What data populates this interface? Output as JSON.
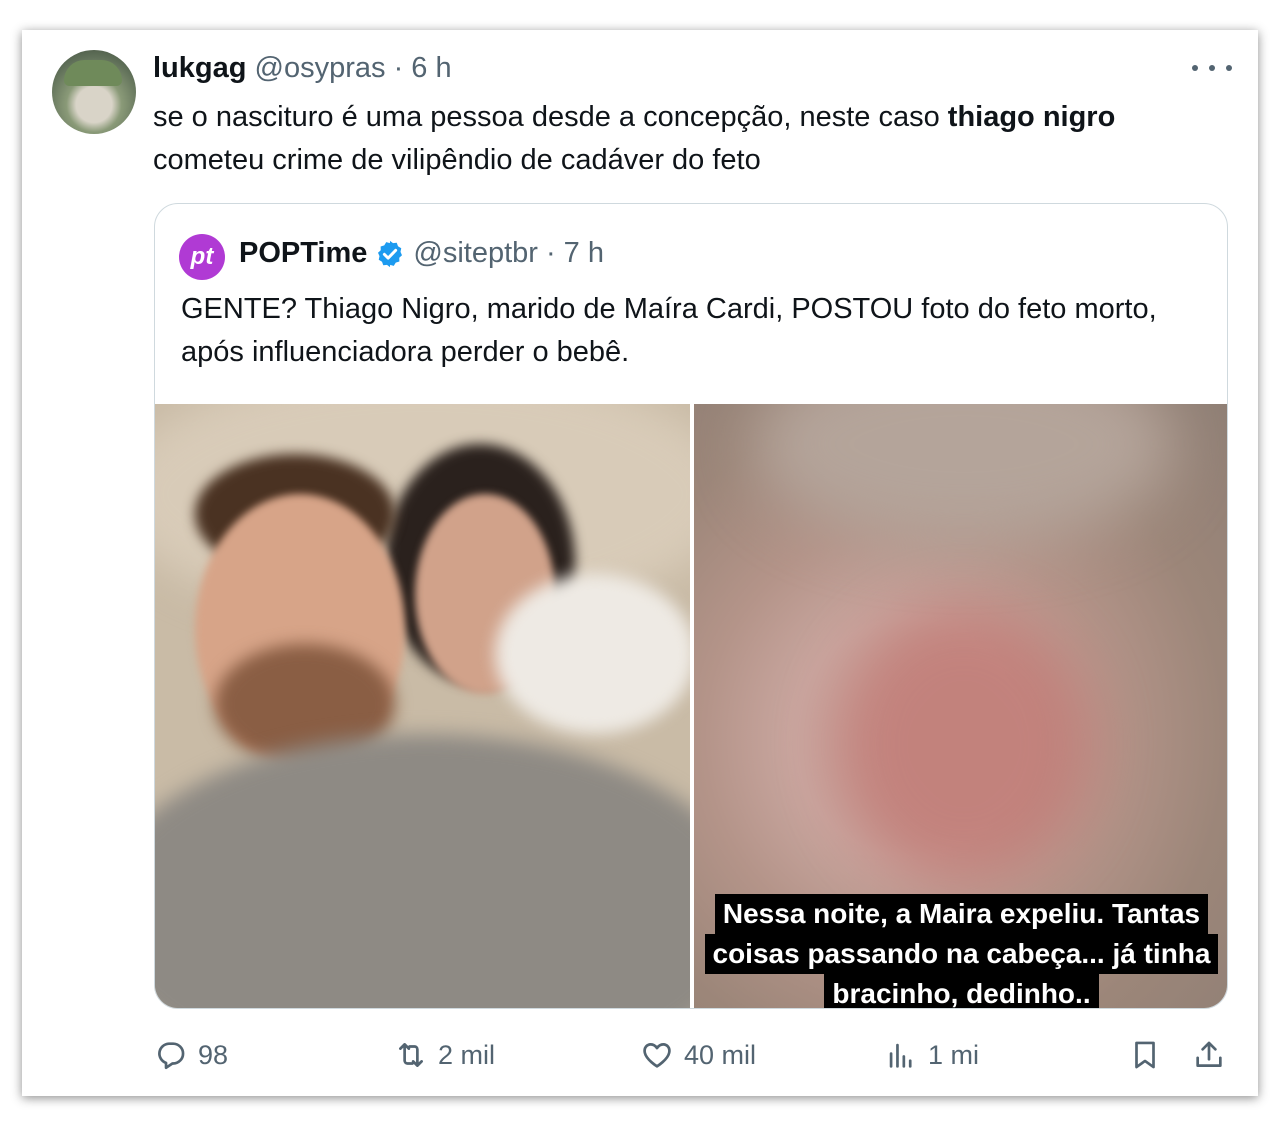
{
  "tweet": {
    "display_name": "lukgag",
    "handle": "@osypras",
    "time": "· 6 h",
    "text_part1": "se o nascituro é uma pessoa desde a concepção, neste caso ",
    "text_bold": "thiago nigro",
    "text_part2": "cometeu crime de vilipêndio de cadáver do feto"
  },
  "quoted": {
    "logo_text": "pt",
    "display_name": "POPTime",
    "handle": "@siteptbr",
    "time": "· 7 h",
    "text": "GENTE? Thiago Nigro, marido de Maíra Cardi, POSTOU foto do feto morto, após influenciadora perder o bebê.",
    "caption_lines": [
      "Nessa noite, a Maira expeliu. Tantas",
      "coisas passando na cabeça... já tinha",
      "bracinho, dedinho.."
    ]
  },
  "actions": {
    "replies": "98",
    "reposts": "2 mil",
    "likes": "40 mil",
    "views": "1 mi"
  },
  "icons": {
    "more": "more-dots-icon",
    "verified": "verified-badge-icon",
    "reply": "reply-icon",
    "repost": "repost-icon",
    "like": "heart-icon",
    "views": "views-chart-icon",
    "bookmark": "bookmark-icon",
    "share": "share-icon"
  },
  "colors": {
    "verified_blue": "#1d9bf0",
    "logo_purple": "#b03ad4",
    "secondary_text": "#536471"
  }
}
